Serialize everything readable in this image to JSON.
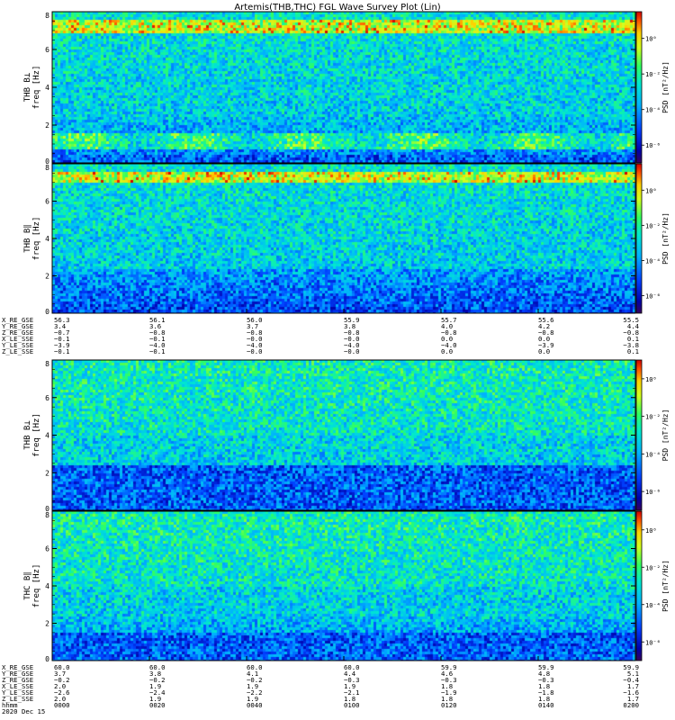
{
  "chart_data": {
    "type": "heatmap",
    "title": "Artemis(THB,THC) FGL Wave Survey Plot (Lin)",
    "colorbar": {
      "label": "PSD [nT²/Hz]",
      "scale": "log",
      "ticks": [
        "10⁰",
        "10⁻²",
        "10⁻⁴",
        "10⁻⁶"
      ]
    },
    "y_ticks": [
      "0",
      "2",
      "4",
      "6",
      "8"
    ],
    "panels": [
      {
        "id": "p1",
        "ylabel_top": "THB B⊥",
        "ylabel": "freq [Hz]",
        "ylim": [
          0,
          8
        ],
        "colorbar_max_exp": 1.5,
        "features": {
          "bright_band": [
            7.0,
            7.6
          ],
          "mid_band": [
            0.8,
            1.6
          ],
          "low_band": [
            0,
            0.5
          ]
        }
      },
      {
        "id": "p2",
        "ylabel_top": "THB B∥",
        "ylabel": "freq [Hz]",
        "ylim": [
          0,
          8
        ],
        "colorbar_max_exp": 1.5,
        "features": {
          "bright_band": [
            7.0,
            7.6
          ],
          "mid_band": null,
          "low_band": [
            0,
            2.5
          ]
        }
      },
      {
        "id": "p3",
        "ylabel_top": "THB B⊥",
        "ylabel": "freq [Hz]",
        "ylim": [
          0,
          8
        ],
        "colorbar_max_exp": 1.0,
        "features": {
          "bright_band": null,
          "mid_band": null,
          "low_band": [
            0,
            2.5
          ]
        }
      },
      {
        "id": "p4",
        "ylabel_top": "THC B∥",
        "ylabel": "freq [Hz]",
        "ylim": [
          0,
          8
        ],
        "colorbar_max_exp": 1.0,
        "features": {
          "bright_band": null,
          "mid_band": null,
          "low_band": [
            0,
            1.5
          ]
        }
      }
    ],
    "ephemeris_blocks": [
      {
        "rows": [
          {
            "label": "X_RE_GSE",
            "values": [
              "56.3",
              "56.1",
              "56.0",
              "55.9",
              "55.7",
              "55.6",
              "55.5"
            ]
          },
          {
            "label": "Y_RE_GSE",
            "values": [
              "3.4",
              "3.6",
              "3.7",
              "3.8",
              "4.0",
              "4.2",
              "4.4"
            ]
          },
          {
            "label": "Z_RE_GSE",
            "values": [
              "−0.7",
              "−0.8",
              "−0.8",
              "−0.8",
              "−0.8",
              "−0.8",
              "−0.8"
            ]
          },
          {
            "label": "X_LE_SSE",
            "values": [
              "−0.1",
              "−0.1",
              "−0.0",
              "−0.0",
              "0.0",
              "0.0",
              "0.1"
            ]
          },
          {
            "label": "Y_LE_SSE",
            "values": [
              "−3.9",
              "−4.0",
              "−4.0",
              "−4.0",
              "−4.0",
              "−3.9",
              "−3.8"
            ]
          },
          {
            "label": "Z_LE_SSE",
            "values": [
              "−0.1",
              "−0.1",
              "−0.0",
              "−0.0",
              "0.0",
              "0.0",
              "0.1"
            ]
          }
        ]
      },
      {
        "rows": [
          {
            "label": "X_RE_GSE",
            "values": [
              "60.0",
              "60.0",
              "60.0",
              "60.0",
              "59.9",
              "59.9",
              "59.9"
            ]
          },
          {
            "label": "Y_RE_GSE",
            "values": [
              "3.7",
              "3.8",
              "4.1",
              "4.4",
              "4.6",
              "4.8",
              "5.1"
            ]
          },
          {
            "label": "Z_RE_GSE",
            "values": [
              "−0.2",
              "−0.2",
              "−0.2",
              "−0.3",
              "−0.3",
              "−0.3",
              "−0.4"
            ]
          },
          {
            "label": "X_LE_SSE",
            "values": [
              "2.0",
              "1.9",
              "1.9",
              "1.9",
              "1.8",
              "1.8",
              "1.7"
            ]
          },
          {
            "label": "Y_LE_SSE",
            "values": [
              "−2.6",
              "−2.4",
              "−2.2",
              "−2.1",
              "−1.9",
              "−1.8",
              "−1.6"
            ]
          },
          {
            "label": "Z_LE_SSE",
            "values": [
              "2.0",
              "1.9",
              "1.9",
              "1.8",
              "1.8",
              "1.8",
              "1.7"
            ]
          },
          {
            "label": "hhmm",
            "values": [
              "0000",
              "0020",
              "0040",
              "0100",
              "0120",
              "0140",
              "0200"
            ]
          }
        ],
        "date": "2020 Dec 15"
      }
    ]
  }
}
